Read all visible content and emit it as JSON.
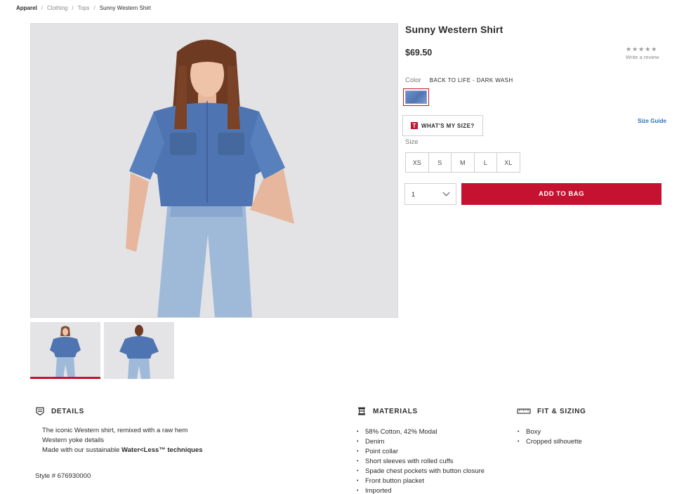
{
  "breadcrumb": [
    "Apparel",
    "Clothing",
    "Tops",
    "Sunny Western Shirt"
  ],
  "product": {
    "title": "Sunny Western Shirt",
    "price": "$69.50",
    "rating": {
      "stars": "★★★★★",
      "write_review": "Write a review"
    },
    "color_label": "Color",
    "color_value": "BACK TO LIFE - DARK WASH",
    "whats_my_size": "WHAT'S MY SIZE?",
    "whats_my_size_icon": "T",
    "size_guide": "Size Guide",
    "size_label": "Size",
    "sizes": [
      "XS",
      "S",
      "M",
      "L",
      "XL"
    ],
    "quantity": "1",
    "add_to_bag": "ADD TO BAG"
  },
  "details": {
    "heading": "DETAILS",
    "lines": [
      "The iconic Western shirt, remixed with a raw hem",
      "Western yoke details"
    ],
    "sustain_prefix": "Made with our sustainable ",
    "sustain_bold": "Water<Less™ techniques",
    "style": "Style # 676930000"
  },
  "materials": {
    "heading": "MATERIALS",
    "items": [
      "58% Cotton, 42% Modal",
      "Denim",
      "Point collar",
      "Short sleeves with rolled cuffs",
      "Spade chest pockets with button closure",
      "Front button placket",
      "Imported"
    ]
  },
  "fit": {
    "heading": "FIT & SIZING",
    "items": [
      "Boxy",
      "Cropped silhouette"
    ]
  },
  "colors": {
    "accent": "#c41230",
    "link": "#2a6ebb"
  }
}
